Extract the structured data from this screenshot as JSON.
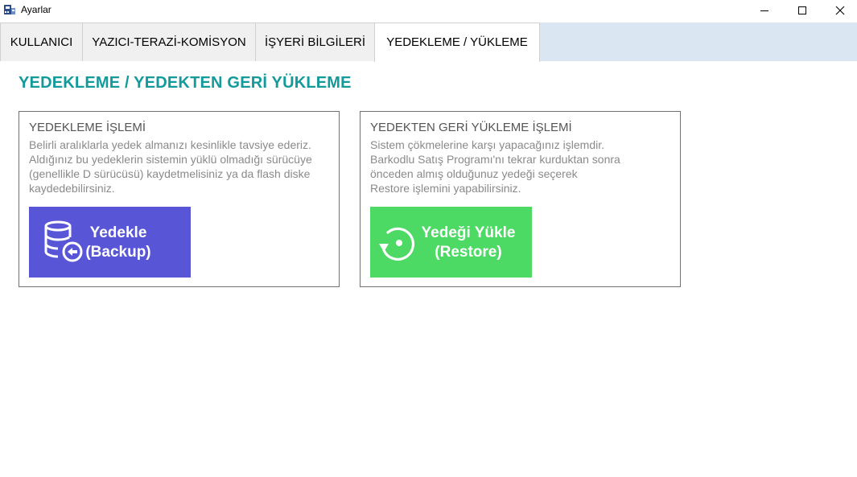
{
  "window": {
    "title": "Ayarlar",
    "minimize_icon": "minimize-icon",
    "maximize_icon": "maximize-icon",
    "close_icon": "close-icon"
  },
  "tabs": [
    {
      "label": "KULLANICI",
      "active": false
    },
    {
      "label": "YAZICI-TERAZİ-KOMİSYON",
      "active": false
    },
    {
      "label": "İŞYERİ BİLGİLERİ",
      "active": false
    },
    {
      "label": "YEDEKLEME / YÜKLEME",
      "active": true
    }
  ],
  "main": {
    "title": "YEDEKLEME / YEDEKTEN GERİ YÜKLEME",
    "title_color": "#139a9b"
  },
  "backup_panel": {
    "heading": "YEDEKLEME İŞLEMİ",
    "description_lines": [
      "Belirli aralıklarla yedek almanızı kesinlikle tavsiye ederiz.",
      "Aldığınız bu yedeklerin sistemin yüklü olmadığı sürücüye",
      "(genellikle D sürücüsü) kaydetmelisiniz ya da flash diske",
      "kaydedebilirsiniz."
    ],
    "button": {
      "line1": "Yedekle",
      "line2": "(Backup)",
      "icon": "database-backup-icon",
      "color": "#5856d6"
    }
  },
  "restore_panel": {
    "heading": "YEDEKTEN GERİ YÜKLEME İŞLEMİ",
    "description_lines": [
      "Sistem çökmelerine karşı yapacağınız işlemdir.",
      "Barkodlu Satış Programı'nı tekrar kurduktan sonra",
      "önceden almış olduğunuz yedeği seçerek",
      "Restore işlemini yapabilirsiniz."
    ],
    "button": {
      "line1": "Yedeği Yükle",
      "line2": "(Restore)",
      "icon": "restore-icon",
      "color": "#4cd964"
    }
  }
}
